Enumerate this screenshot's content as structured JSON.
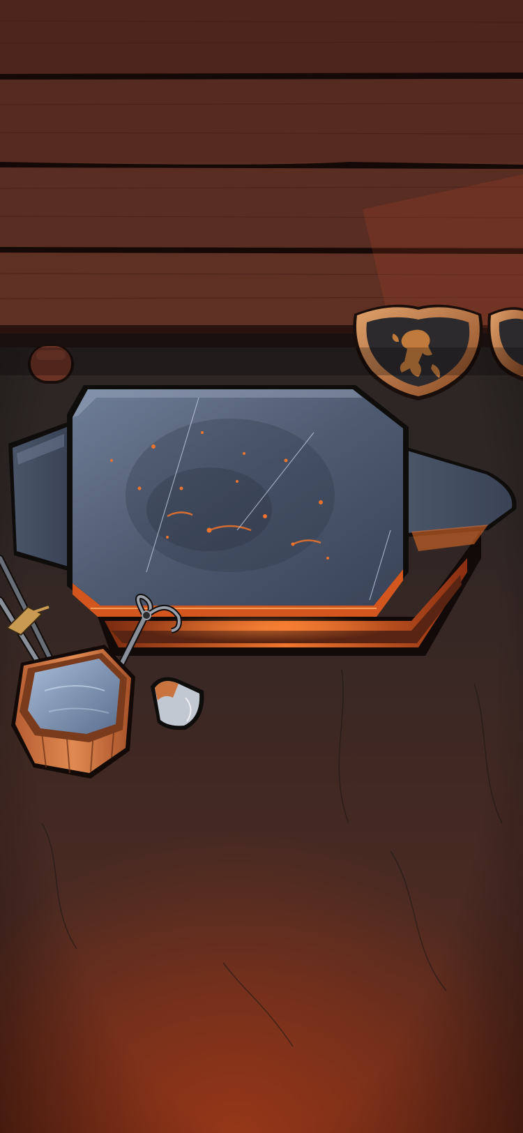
{
  "screen": {
    "name": "blacksmith-forge-scene",
    "text_elements": []
  },
  "palette": {
    "wood_dark": "#3a1d16",
    "wood_mid": "#5a2c22",
    "wood_light": "#6e3829",
    "floor_top": "#2a2625",
    "floor_bottom": "#6a2a18",
    "anvil_face": "#5e6d85",
    "anvil_dark": "#2e3644",
    "ember": "#f06a28",
    "copper": "#c9743e",
    "water": "#8aa2c4"
  },
  "objects": [
    {
      "name": "wooden-wall-shelf",
      "icon": "wood-planks"
    },
    {
      "name": "wooden-peg",
      "icon": "round-peg"
    },
    {
      "name": "lion-crest-shield",
      "icon": "lion-shield-icon"
    },
    {
      "name": "second-shield",
      "icon": "shield-icon"
    },
    {
      "name": "anvil",
      "icon": "anvil-icon"
    },
    {
      "name": "water-bucket",
      "icon": "bucket-icon"
    },
    {
      "name": "tongs",
      "icon": "tongs-icon"
    },
    {
      "name": "axe-head",
      "icon": "axe-icon"
    }
  ]
}
